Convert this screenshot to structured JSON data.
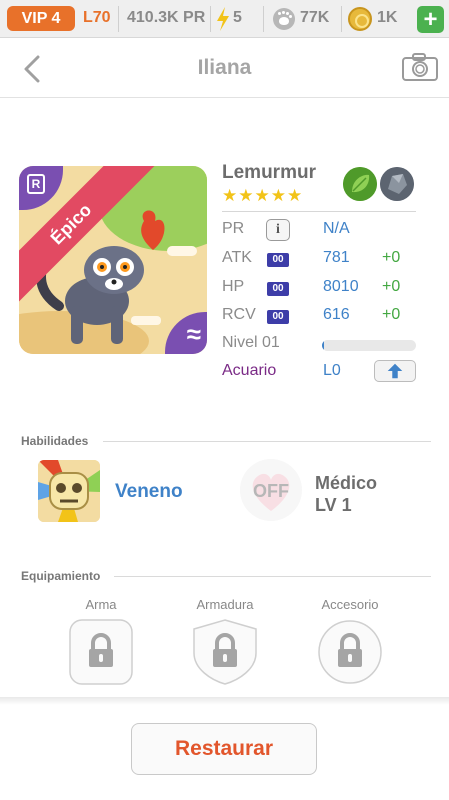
{
  "topbar": {
    "vip": "VIP 4",
    "level": "L70",
    "power": "410.3K PR",
    "energy": "5",
    "paws": "77K",
    "coins": "1K",
    "plus": "+"
  },
  "header": {
    "title": "Iliana"
  },
  "card": {
    "rarity": "Épico",
    "rank_badge": "R",
    "element_badge": "≈"
  },
  "monster": {
    "name": "Lemurmur",
    "stars": "★★★★★",
    "stars_count": 5,
    "elements": [
      "leaf-icon",
      "rock-icon"
    ],
    "stats": [
      {
        "label": "PR",
        "value": "N/A"
      },
      {
        "label": "ATK",
        "badge": "00",
        "value": "781",
        "bonus": "+0"
      },
      {
        "label": "HP",
        "badge": "00",
        "value": "8010",
        "bonus": "+0"
      },
      {
        "label": "RCV",
        "badge": "00",
        "value": "616",
        "bonus": "+0"
      }
    ],
    "level_label": "Nivel 01",
    "level_progress": 0.02,
    "habitat_label": "Acuario",
    "habitat_value": "L0"
  },
  "skills": {
    "title": "Habilidades",
    "active_name": "Veneno",
    "off_label": "OFF",
    "leader_name": "Médico",
    "leader_level": "LV 1"
  },
  "equipment": {
    "title": "Equipamiento",
    "slots": [
      "Arma",
      "Armadura",
      "Accesorio"
    ]
  },
  "footer": {
    "restore_label": "Restaurar"
  },
  "colors": {
    "accent_orange": "#e8712a",
    "stat_blue": "#3f82c8",
    "bonus_green": "#44a842",
    "epic_pink": "#e24a62",
    "badge_purple": "#7a4fb1"
  }
}
